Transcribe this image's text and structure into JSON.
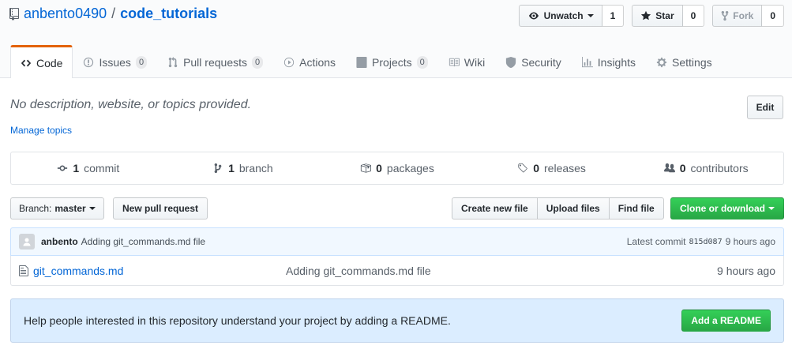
{
  "repo": {
    "owner": "anbento0490",
    "separator": "/",
    "name": "code_tutorials"
  },
  "actions": {
    "watch_label": "Unwatch",
    "watch_count": "1",
    "star_label": "Star",
    "star_count": "0",
    "fork_label": "Fork",
    "fork_count": "0"
  },
  "tabs": [
    {
      "label": "Code",
      "icon": "code-icon",
      "selected": true
    },
    {
      "label": "Issues",
      "count": "0",
      "icon": "issue-icon"
    },
    {
      "label": "Pull requests",
      "count": "0",
      "icon": "pull-request-icon"
    },
    {
      "label": "Actions",
      "icon": "play-icon"
    },
    {
      "label": "Projects",
      "count": "0",
      "icon": "project-icon"
    },
    {
      "label": "Wiki",
      "icon": "book-icon"
    },
    {
      "label": "Security",
      "icon": "shield-icon"
    },
    {
      "label": "Insights",
      "icon": "graph-icon"
    },
    {
      "label": "Settings",
      "icon": "gear-icon"
    }
  ],
  "about": {
    "description": "No description, website, or topics provided.",
    "edit_label": "Edit",
    "manage_topics": "Manage topics"
  },
  "numbers": {
    "commits_count": "1",
    "commits_label": "commit",
    "branches_count": "1",
    "branches_label": "branch",
    "packages_count": "0",
    "packages_label": "packages",
    "releases_count": "0",
    "releases_label": "releases",
    "contributors_count": "0",
    "contributors_label": "contributors"
  },
  "file_nav": {
    "branch_prefix": "Branch:",
    "branch_name": "master",
    "new_pr": "New pull request",
    "create_file": "Create new file",
    "upload_files": "Upload files",
    "find_file": "Find file",
    "clone": "Clone or download"
  },
  "latest_commit": {
    "author": "anbento",
    "message": "Adding git_commands.md file",
    "prefix": "Latest commit",
    "sha": "815d087",
    "age": "9 hours ago"
  },
  "files": [
    {
      "name": "git_commands.md",
      "message": "Adding git_commands.md file",
      "age": "9 hours ago"
    }
  ],
  "readme_prompt": {
    "text": "Help people interested in this repository understand your project by adding a README.",
    "button": "Add a README"
  },
  "colors": {
    "link": "#0366d6",
    "tab_accent": "#e36209",
    "green": "#28a745",
    "banner": "#dbedff"
  }
}
